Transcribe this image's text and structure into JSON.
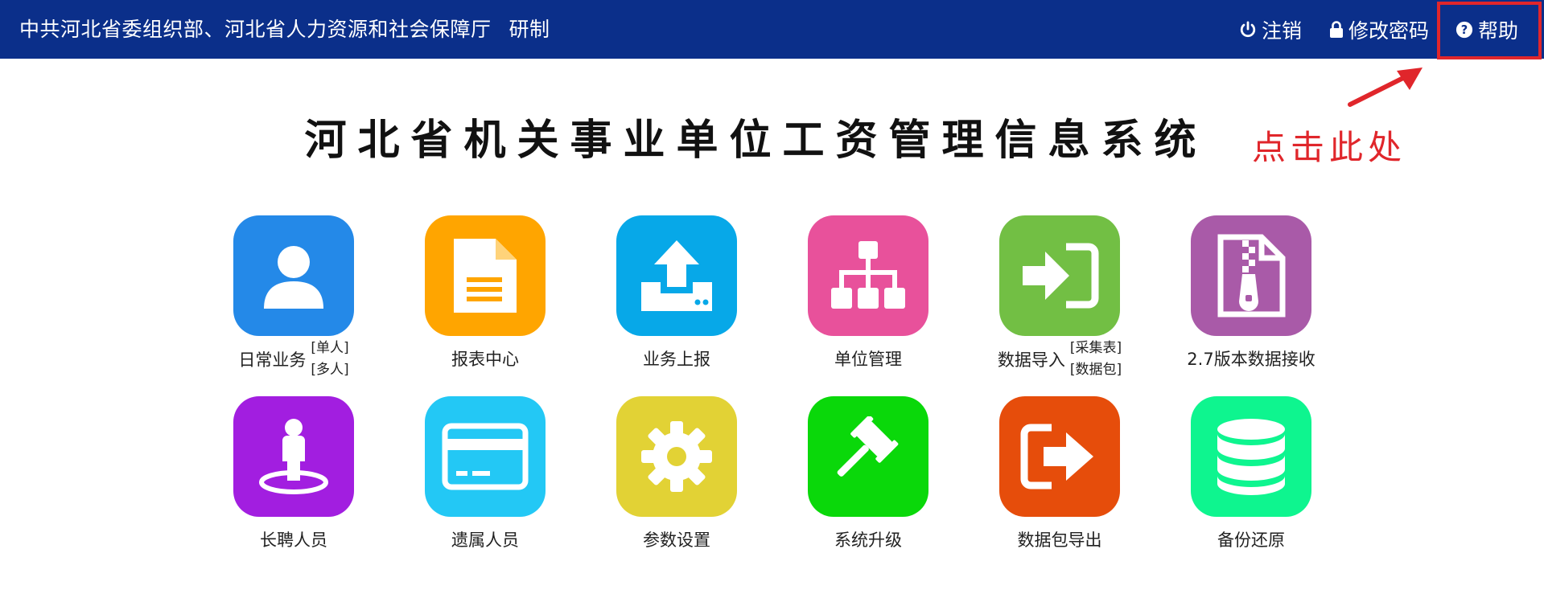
{
  "header": {
    "org": "中共河北省委组织部、河北省人力资源和社会保障厅",
    "developer": "研制",
    "logout_label": "注销",
    "change_password_label": "修改密码",
    "help_label": "帮助",
    "bg_color": "#0b2f8a"
  },
  "annotation": {
    "hint": "点击此处",
    "color": "#e0262b"
  },
  "title": "河北省机关事业单位工资管理信息系统",
  "tiles": [
    {
      "label": "日常业务",
      "subs": [
        "[单人]",
        "[多人]"
      ],
      "color": "#2489e8",
      "icon": "user-icon"
    },
    {
      "label": "报表中心",
      "color": "#ffa500",
      "icon": "document-icon"
    },
    {
      "label": "业务上报",
      "color": "#07a8e8",
      "icon": "upload-icon"
    },
    {
      "label": "单位管理",
      "color": "#e8519b",
      "icon": "sitemap-icon"
    },
    {
      "label": "数据导入",
      "subs": [
        "[采集表]",
        "[数据包]"
      ],
      "color": "#72bf44",
      "icon": "sign-in-icon"
    },
    {
      "label": "2.7版本数据接收",
      "color": "#a95aa8",
      "icon": "zip-file-icon"
    },
    {
      "label": "长聘人员",
      "color": "#a21ee0",
      "icon": "street-view-icon"
    },
    {
      "label": "遗属人员",
      "color": "#23c8f5",
      "icon": "credit-card-icon"
    },
    {
      "label": "参数设置",
      "color": "#e2d235",
      "icon": "gear-icon"
    },
    {
      "label": "系统升级",
      "color": "#0ad80a",
      "icon": "gavel-icon"
    },
    {
      "label": "数据包导出",
      "color": "#e64d0b",
      "icon": "sign-out-icon"
    },
    {
      "label": "备份还原",
      "color": "#0ef58f",
      "icon": "database-icon"
    }
  ]
}
